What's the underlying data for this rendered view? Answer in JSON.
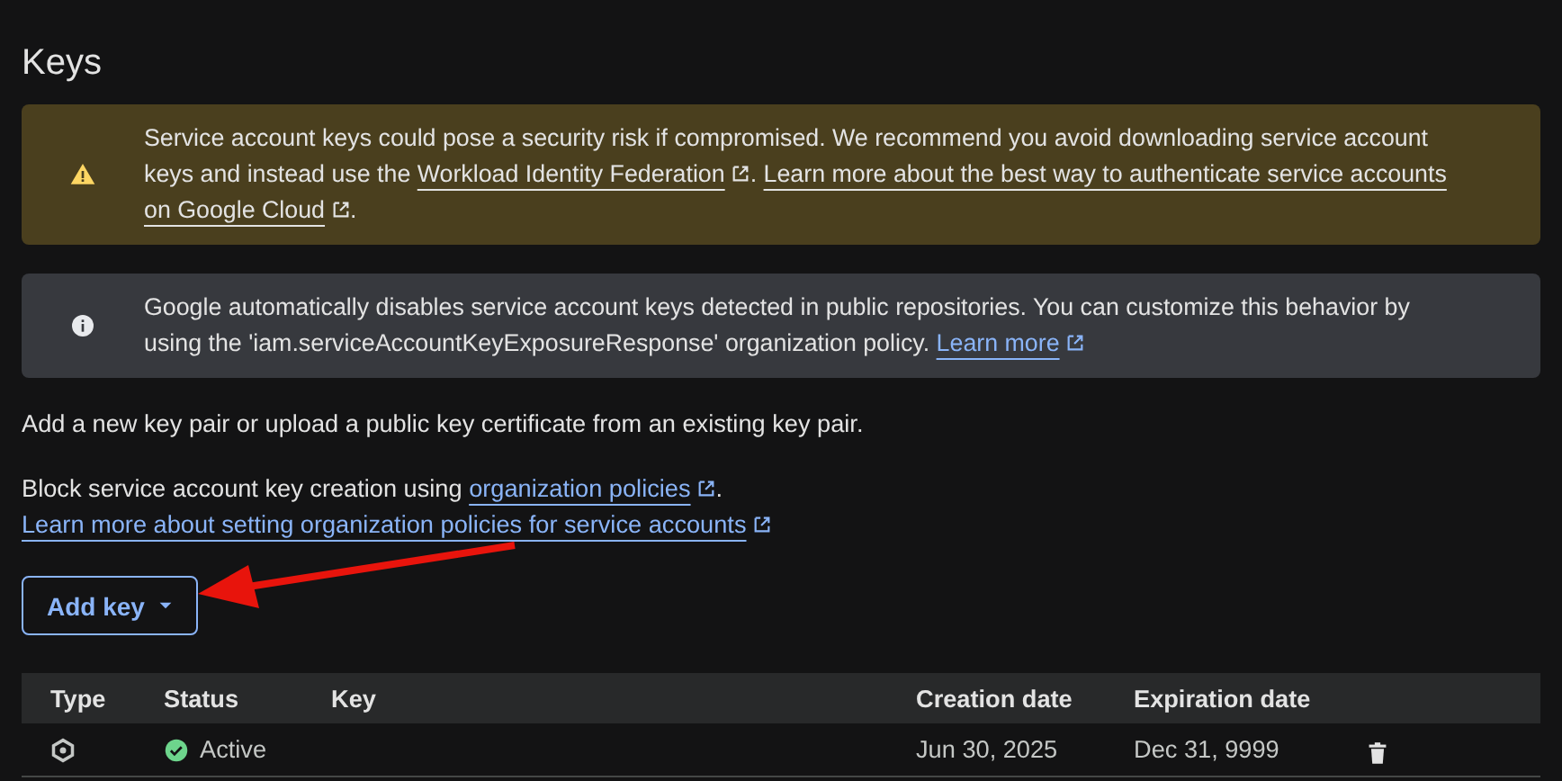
{
  "title": "Keys",
  "banners": [
    {
      "kind": "warning",
      "parts": [
        {
          "kind": "text",
          "text": "Service account keys could pose a security risk if compromised. We recommend you avoid downloading service account keys and instead use the "
        },
        {
          "kind": "link",
          "text": "Workload Identity Federation",
          "external": true
        },
        {
          "kind": "text",
          "text": ". "
        },
        {
          "kind": "link",
          "text": "Learn more about the best way to authenticate service accounts",
          "external": false
        },
        {
          "kind": "link",
          "text": "on Google Cloud",
          "external": true
        },
        {
          "kind": "text",
          "text": "."
        }
      ]
    },
    {
      "kind": "info",
      "parts": [
        {
          "kind": "text",
          "text": "Google automatically disables service account keys detected in public repositories. You can customize this behavior by using the 'iam.serviceAccountKeyExposureResponse' organization policy. "
        },
        {
          "kind": "link",
          "text": "Learn more",
          "external": true
        }
      ]
    }
  ],
  "paragraphs": [
    [
      {
        "kind": "text",
        "text": "Add a new key pair or upload a public key certificate from an existing key pair."
      }
    ],
    [
      {
        "kind": "text",
        "text": "Block service account key creation using "
      },
      {
        "kind": "link",
        "text": "organization policies",
        "external": true
      },
      {
        "kind": "text",
        "text": "."
      }
    ],
    [
      {
        "kind": "link",
        "text": "Learn more about setting organization policies for service accounts",
        "external": true
      }
    ]
  ],
  "add_key_button": {
    "label": "Add key"
  },
  "table": {
    "columns": [
      "Type",
      "Status",
      "Key",
      "Creation date",
      "Expiration date"
    ],
    "rows": [
      {
        "status": "Active",
        "creation_date": "Jun 30, 2025",
        "expiration_date": "Dec 31, 9999"
      }
    ]
  }
}
